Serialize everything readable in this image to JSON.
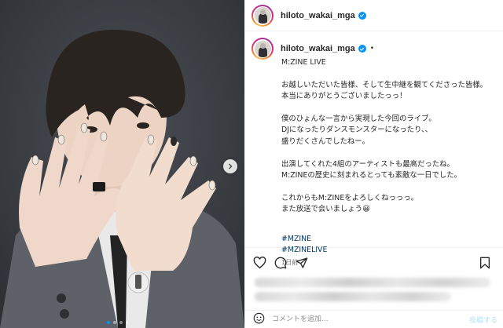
{
  "post": {
    "username": "hiloto_wakai_mga",
    "separator_dot": "•",
    "caption_lines": [
      "M:ZINE LIVE",
      "",
      "お越しいただいた皆様、そして生中継を観てくださった皆様。",
      "本当にありがとうございましたっっ！",
      "",
      "僕のひょんな一言から実現した今回のライブ。",
      "DJになったりダンスモンスターになったり、、",
      "盛りだくさんでしたねー。",
      "",
      "出演してくれた4組のアーティストも最高だったね。",
      "M:ZINEの歴史に刻まれるとっても素敵な一日でした。",
      "",
      "これからもM:ZINEをよろしくねっっっ。",
      "また放送で会いましょう😀"
    ],
    "hashtags": [
      "#MZINE",
      "#MZINELIVE"
    ],
    "time_ago": "1日前"
  },
  "carousel": {
    "slide_count": 4,
    "active_index": 0
  },
  "comment": {
    "placeholder": "コメントを追加...",
    "post_label": "投稿する"
  },
  "icons": {
    "verified": "verified-badge-icon",
    "like": "heart-icon",
    "comment": "comment-icon",
    "share": "paper-plane-icon",
    "save": "bookmark-icon",
    "emoji": "smiley-icon",
    "next": "chevron-right-icon"
  },
  "colors": {
    "accent": "#0095f6",
    "hashtag": "#00376b",
    "muted": "#737373",
    "post_button_disabled": "#b2dffc"
  }
}
